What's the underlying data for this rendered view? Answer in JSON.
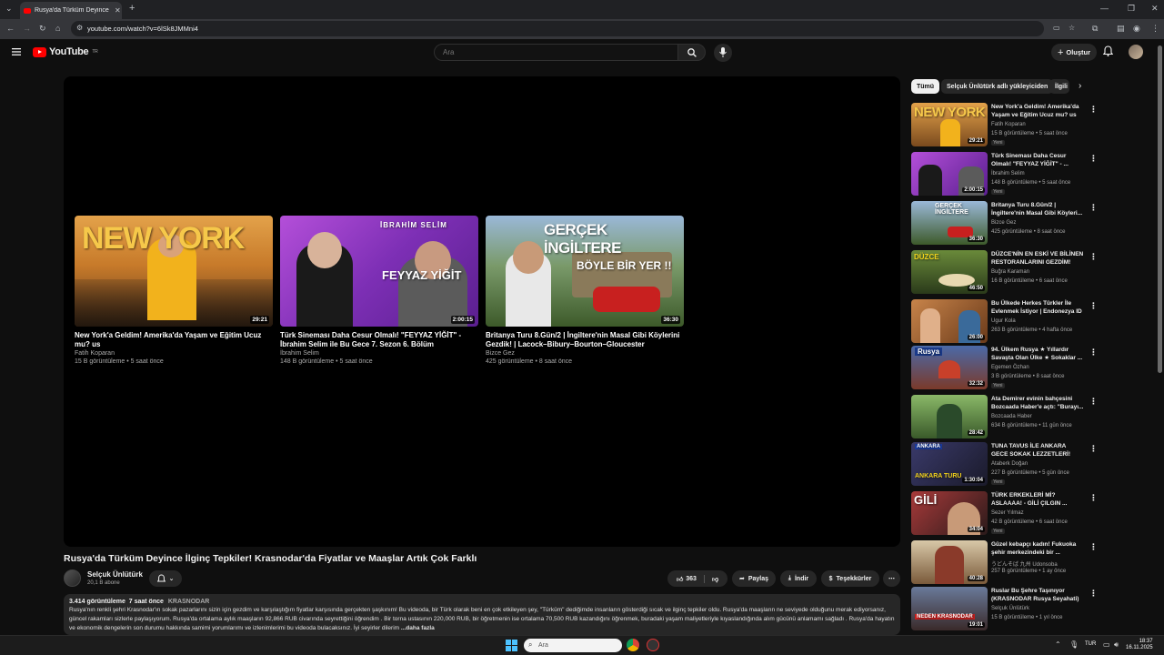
{
  "browser": {
    "tab_title": "Rusya'da Türküm Deyince İlginç",
    "url": "youtube.com/watch?v=6lSk8JMMni4"
  },
  "header": {
    "logo_text": "YouTube",
    "region": "TR",
    "search_placeholder": "Ara",
    "create_label": "Oluştur"
  },
  "endscreen": [
    {
      "title": "New York'a Geldim! Amerika'da Yaşam ve Eğitim Ucuz mu? us",
      "channel": "Fatih Koparan",
      "meta": "15 B görüntüleme • 5 saat önce",
      "duration": "29:21",
      "overlay": "NEW YORK"
    },
    {
      "title": "Türk Sineması Daha Cesur Olmalı! \"FEYYAZ YİĞİT\" - İbrahim Selim ile Bu Gece 7. Sezon 6. Bölüm",
      "channel": "İbrahim Selim",
      "meta": "148 B görüntüleme • 5 saat önce",
      "duration": "2:00:15",
      "overlay": "FEYYAZ YİĞİT",
      "overlay2": "İBRAHİM SELİM"
    },
    {
      "title": "Britanya Turu 8.Gün/2 | İngiltere'nin Masal Gibi Köylerini Gezdik! | Lacock–Bibury–Bourton–Gloucester",
      "channel": "Bizce Gez",
      "meta": "425 görüntüleme • 8 saat önce",
      "duration": "36:30",
      "overlay": "GERÇEK İNGİLTERE",
      "overlay2": "BÖYLE BİR YER !!"
    }
  ],
  "video": {
    "title": "Rusya'da Türküm Deyince İlginç Tepkiler! Krasnodar'da Fiyatlar ve Maaşlar Artık Çok Farklı",
    "channel": "Selçuk Ünlütürk",
    "subs": "20,1 B abone",
    "likes": "363",
    "share": "Paylaş",
    "download": "İndir",
    "thanks": "Teşekkürler",
    "views": "3.414 görüntüleme",
    "age": "7 saat önce",
    "tag": "KRASNODAR",
    "description": "Rusya'nın renkli şehri Krasnodar'ın sokak pazarlarını sizin için gezdim ve karşılaştığım fiyatlar karşısında gerçekten şaşkınım! Bu videoda, bir Türk olarak beni en çok etkileyen şey, \"Türküm\" dediğimde insanların gösterdiği sıcak ve ilginç tepkiler oldu. Rusya'da maaşların ne seviyede olduğunu merak ediyorsanız, güncel rakamları sizlerle paylaşıyorum. Rusya'da ortalama aylık maaşların 92,866 RUB civarında seyrettiğini öğrendim . Bir torna ustasının 220,000 RUB, bir öğretmenin ise ortalama 70,500 RUB kazandığını öğrenmek, buradaki yaşam maliyetleriyle kıyaslandığında alım gücünü anlamamı sağladı . Rusya'da hayatın ve ekonomik dengelerin son durumu hakkında samimi yorumlarımı ve izlenimlerimi bu videoda bulacaksınız. İyi seyirler dilerim",
    "more": "...daha fazla"
  },
  "chips": [
    "Tümü",
    "Selçuk Ünlütürk adlı yükleyiciden",
    "İlgili"
  ],
  "sidebar": [
    {
      "title": "New York'a Geldim! Amerika'da Yaşam ve Eğitim Ucuz mu? us",
      "channel": "Fatih Koparan",
      "meta": "15 B görüntüleme • 5 saat önce",
      "badge": "Yeni",
      "duration": "29:21"
    },
    {
      "title": "Türk Sineması Daha Cesur Olmalı! \"FEYYAZ YİĞİT\" - ...",
      "channel": "İbrahim Selim",
      "meta": "148 B görüntüleme • 5 saat önce",
      "badge": "Yeni",
      "duration": "2:00:15"
    },
    {
      "title": "Britanya Turu 8.Gün/2 | İngiltere'nin Masal Gibi Köyleri...",
      "channel": "Bizce Gez",
      "meta": "425 görüntüleme • 8 saat önce",
      "badge": "",
      "duration": "36:30"
    },
    {
      "title": "DÜZCE'NİN EN ESKİ VE BİLİNEN RESTORANLARINI GEZDİM!",
      "channel": "Buğra Karaman",
      "meta": "16 B görüntüleme • 6 saat önce",
      "badge": "",
      "duration": "46:50"
    },
    {
      "title": "Bu Ülkede Herkes Türkler İle Evlenmek İstiyor | Endonezya ID",
      "channel": "Ugur Kola",
      "meta": "263 B görüntüleme • 4 hafta önce",
      "badge": "",
      "duration": "26:00"
    },
    {
      "title": "94. Ülkem Rusya ★ Yıllardır Savaşta Olan Ülke ★ Sokaklar ...",
      "channel": "Egemen Özhan",
      "meta": "3 B görüntüleme • 8 saat önce",
      "badge": "Yeni",
      "duration": "32:32"
    },
    {
      "title": "Ata Demirer evinin bahçesini Bozcaada Haber'e açtı: \"Burayı...",
      "channel": "Bozcaada Haber",
      "meta": "634 B görüntüleme • 11 gün önce",
      "badge": "",
      "duration": "28:42"
    },
    {
      "title": "TUNA TAVUS İLE ANKARA GECE SOKAK LEZZETLERİ!",
      "channel": "Ataberk Doğan",
      "meta": "227 B görüntüleme • 5 gün önce",
      "badge": "Yeni",
      "duration": "1:30:04"
    },
    {
      "title": "TÜRK ERKEKLERİ Mİ? ASLAAAA! - GİLİ ÇILGIN ...",
      "channel": "Sezer Yılmaz",
      "meta": "42 B görüntüleme • 6 saat önce",
      "badge": "Yeni",
      "duration": "34:04"
    },
    {
      "title": "Güzel kebapçı kadın! Fukuoka şehir merkezindeki bir ...",
      "channel": "うどんそば 九州 Udonsoba",
      "meta": "257 B görüntüleme • 1 ay önce",
      "badge": "",
      "duration": "40:28"
    },
    {
      "title": "Ruslar Bu Şehre Taşınıyor (KRASNODAR Rusya Seyahati)",
      "channel": "Selçuk Ünlütürk",
      "meta": "15 B görüntüleme • 1 yıl önce",
      "badge": "",
      "duration": "19:01"
    }
  ],
  "taskbar": {
    "search": "Ara",
    "lang": "TUR",
    "time": "18:37",
    "date": "16.11.2025"
  }
}
